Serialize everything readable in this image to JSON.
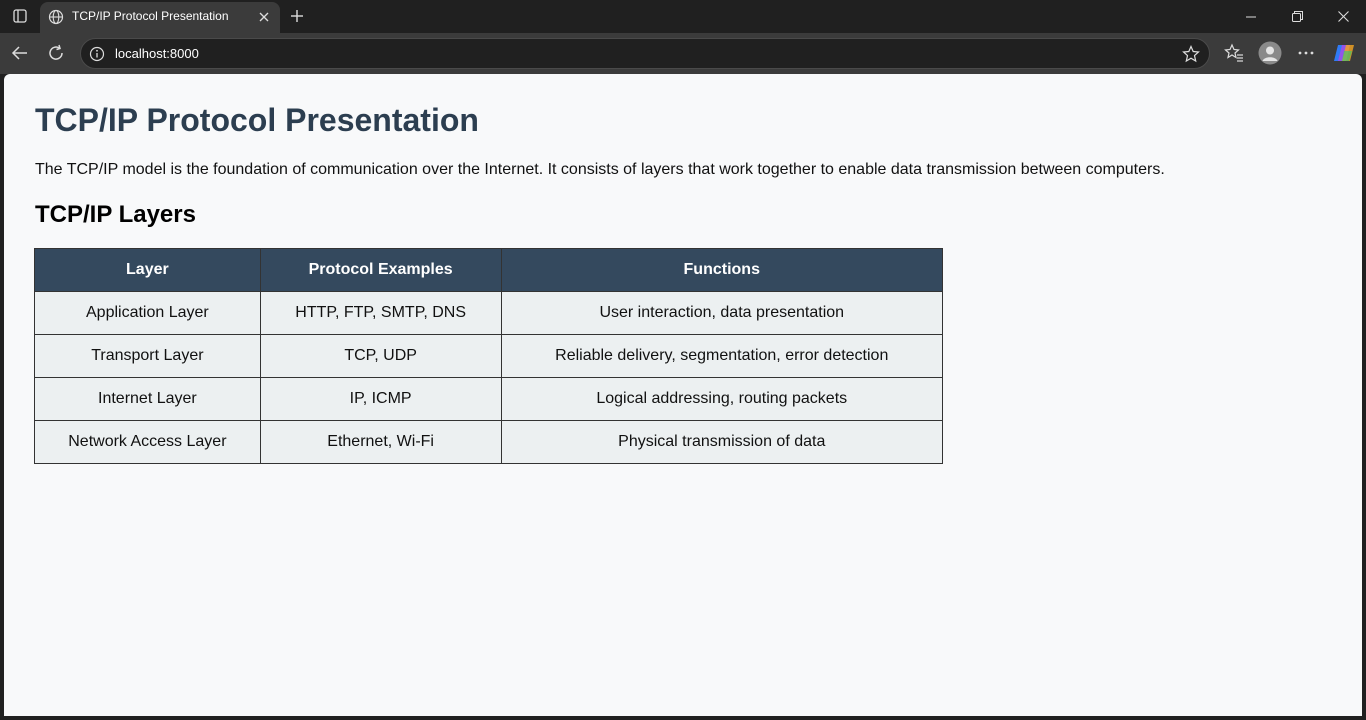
{
  "browser": {
    "tab_title": "TCP/IP Protocol Presentation",
    "url": "localhost:8000"
  },
  "page": {
    "title": "TCP/IP Protocol Presentation",
    "intro": "The TCP/IP model is the foundation of communication over the Internet. It consists of layers that work together to enable data transmission between computers.",
    "section_title": "TCP/IP Layers",
    "table": {
      "headers": [
        "Layer",
        "Protocol Examples",
        "Functions"
      ],
      "rows": [
        [
          "Application Layer",
          "HTTP, FTP, SMTP, DNS",
          "User interaction, data presentation"
        ],
        [
          "Transport Layer",
          "TCP, UDP",
          "Reliable delivery, segmentation, error detection"
        ],
        [
          "Internet Layer",
          "IP, ICMP",
          "Logical addressing, routing packets"
        ],
        [
          "Network Access Layer",
          "Ethernet, Wi-Fi",
          "Physical transmission of data"
        ]
      ]
    }
  },
  "colors": {
    "heading": "#2c3e50",
    "table_header_bg": "#34495e",
    "table_cell_bg": "#ecf0f1",
    "page_bg": "#f8f9fa"
  },
  "icons": [
    "tab-actions-icon",
    "globe-icon",
    "close-icon",
    "plus-icon",
    "minimize-icon",
    "restore-icon",
    "window-close-icon",
    "back-arrow-icon",
    "reload-icon",
    "info-icon",
    "star-icon",
    "favorites-icon",
    "profile-icon",
    "more-icon",
    "copilot-icon"
  ]
}
